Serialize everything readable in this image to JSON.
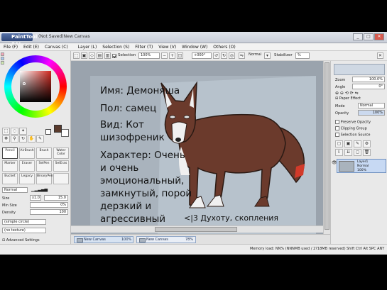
{
  "app": {
    "logo_text": "PaintTool SAI",
    "title": "(Not Saved)New Canvas"
  },
  "window_buttons": [
    "_",
    "□",
    "✕"
  ],
  "menu": [
    "File (F)",
    "Edit (E)",
    "Canvas (C)",
    "Layer (L)",
    "Selection (S)",
    "Filter (T)",
    "View (V)",
    "Window (W)",
    "Others (O)"
  ],
  "toolbar": {
    "selection_label": "Selection",
    "zoom": "100%",
    "angle": "+000°",
    "blend": "Normal",
    "stabilizer_label": "Stabilizer",
    "stabilizer_value": "%"
  },
  "color": {
    "hue": "#d0271e",
    "primary": "#5a3a2c",
    "secondary": "#ffffff"
  },
  "tool_icons": [
    "select-rect-icon",
    "lasso-icon",
    "magic-wand-icon",
    "move-icon",
    "zoom-icon",
    "rotate-icon",
    "hand-icon",
    "eyedropper-icon"
  ],
  "brushes": [
    {
      "label": "Pencil",
      "sel": true
    },
    {
      "label": "AirBrush",
      "sel": false
    },
    {
      "label": "Brush",
      "sel": false
    },
    {
      "label": "Water Color",
      "sel": false
    },
    {
      "label": "Marker",
      "sel": false
    },
    {
      "label": "Eraser",
      "sel": false
    },
    {
      "label": "SelPen",
      "sel": false
    },
    {
      "label": "SelEras",
      "sel": false
    },
    {
      "label": "Bucket",
      "sel": false
    },
    {
      "label": "Legacy",
      "sel": false
    },
    {
      "label": "BinaryPen",
      "sel": false
    },
    {
      "label": "",
      "sel": false
    }
  ],
  "brush_settings": {
    "mode": "Normal",
    "size_label": "Size",
    "size_mult": "x1.0",
    "size_value": "15.0",
    "min_size_label": "Min Size",
    "min_size_value": "0%",
    "density_label": "Density",
    "density_value": "100",
    "shape": "(simple circle)",
    "texture": "(no texture)",
    "advanced": "Advanced Settings"
  },
  "canvas": {
    "bg_color": "#a9b3bd",
    "lines": [
      "Имя: Демоняша",
      "Пол: самец",
      "Вид: Кот",
      "шизофреник",
      "Характер: Очень",
      "и очень",
      "эмоциональный,",
      "замкнутый, порой",
      "дерзкий и",
      "агрессивный"
    ],
    "footer": "<|3 Духоту, скопления"
  },
  "tabs": [
    {
      "label": "New Canvas",
      "zoom": "100%"
    },
    {
      "label": "New Canvas",
      "zoom": "78%"
    }
  ],
  "status": {
    "memory": "Memory load: NN% (NNNMB used / 2?18MB reserved)",
    "keys": "Shift Ctrl Alt SPC ANY"
  },
  "right_panel": {
    "zoom_label": "Zoom",
    "zoom_value": "100.0%",
    "angle_label": "Angle",
    "angle_value": "0°",
    "paper_effect": "Paper Effect",
    "mode_label": "Mode",
    "mode_value": "Normal",
    "opacity_label": "Opacity",
    "opacity_value": "100%",
    "preserve_opacity": "Preserve Opacity",
    "clipping_group": "Clipping Group",
    "selection_source": "Selection Source",
    "layer_name": "Layer1",
    "layer_mode": "Normal",
    "layer_opacity": "100%"
  }
}
